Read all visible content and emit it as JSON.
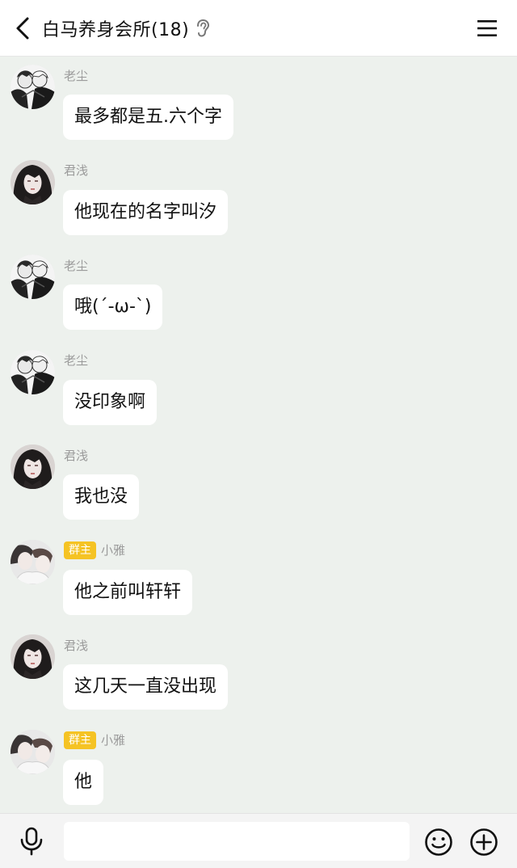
{
  "header": {
    "title": "白马养身会所(18)",
    "back_icon": "chevron-left-icon",
    "ear_icon": "ear-icon",
    "menu_icon": "hamburger-menu-icon"
  },
  "messages": [
    {
      "sender": "老尘",
      "role": "",
      "text": "最多都是五.六个字",
      "avatar": "laochen"
    },
    {
      "sender": "君浅",
      "role": "",
      "text": "他现在的名字叫汐",
      "avatar": "junqian"
    },
    {
      "sender": "老尘",
      "role": "",
      "text": "哦(´-ω-`)",
      "avatar": "laochen"
    },
    {
      "sender": "老尘",
      "role": "",
      "text": "没印象啊",
      "avatar": "laochen"
    },
    {
      "sender": "君浅",
      "role": "",
      "text": "我也没",
      "avatar": "junqian"
    },
    {
      "sender": "小雅",
      "role": "群主",
      "text": "他之前叫轩轩",
      "avatar": "xiaoya"
    },
    {
      "sender": "君浅",
      "role": "",
      "text": "这几天一直没出现",
      "avatar": "junqian"
    },
    {
      "sender": "小雅",
      "role": "群主",
      "text": "他",
      "avatar": "xiaoya"
    }
  ],
  "input": {
    "value": "",
    "placeholder": ""
  },
  "toolbar": {
    "mic_icon": "microphone-icon",
    "emoji_icon": "smiley-icon",
    "plus_icon": "plus-circle-icon"
  },
  "colors": {
    "chat_bg": "#edf1ed",
    "bubble": "#ffffff",
    "role_badge": "#f5c324",
    "sender_name": "#9b9b9b"
  }
}
